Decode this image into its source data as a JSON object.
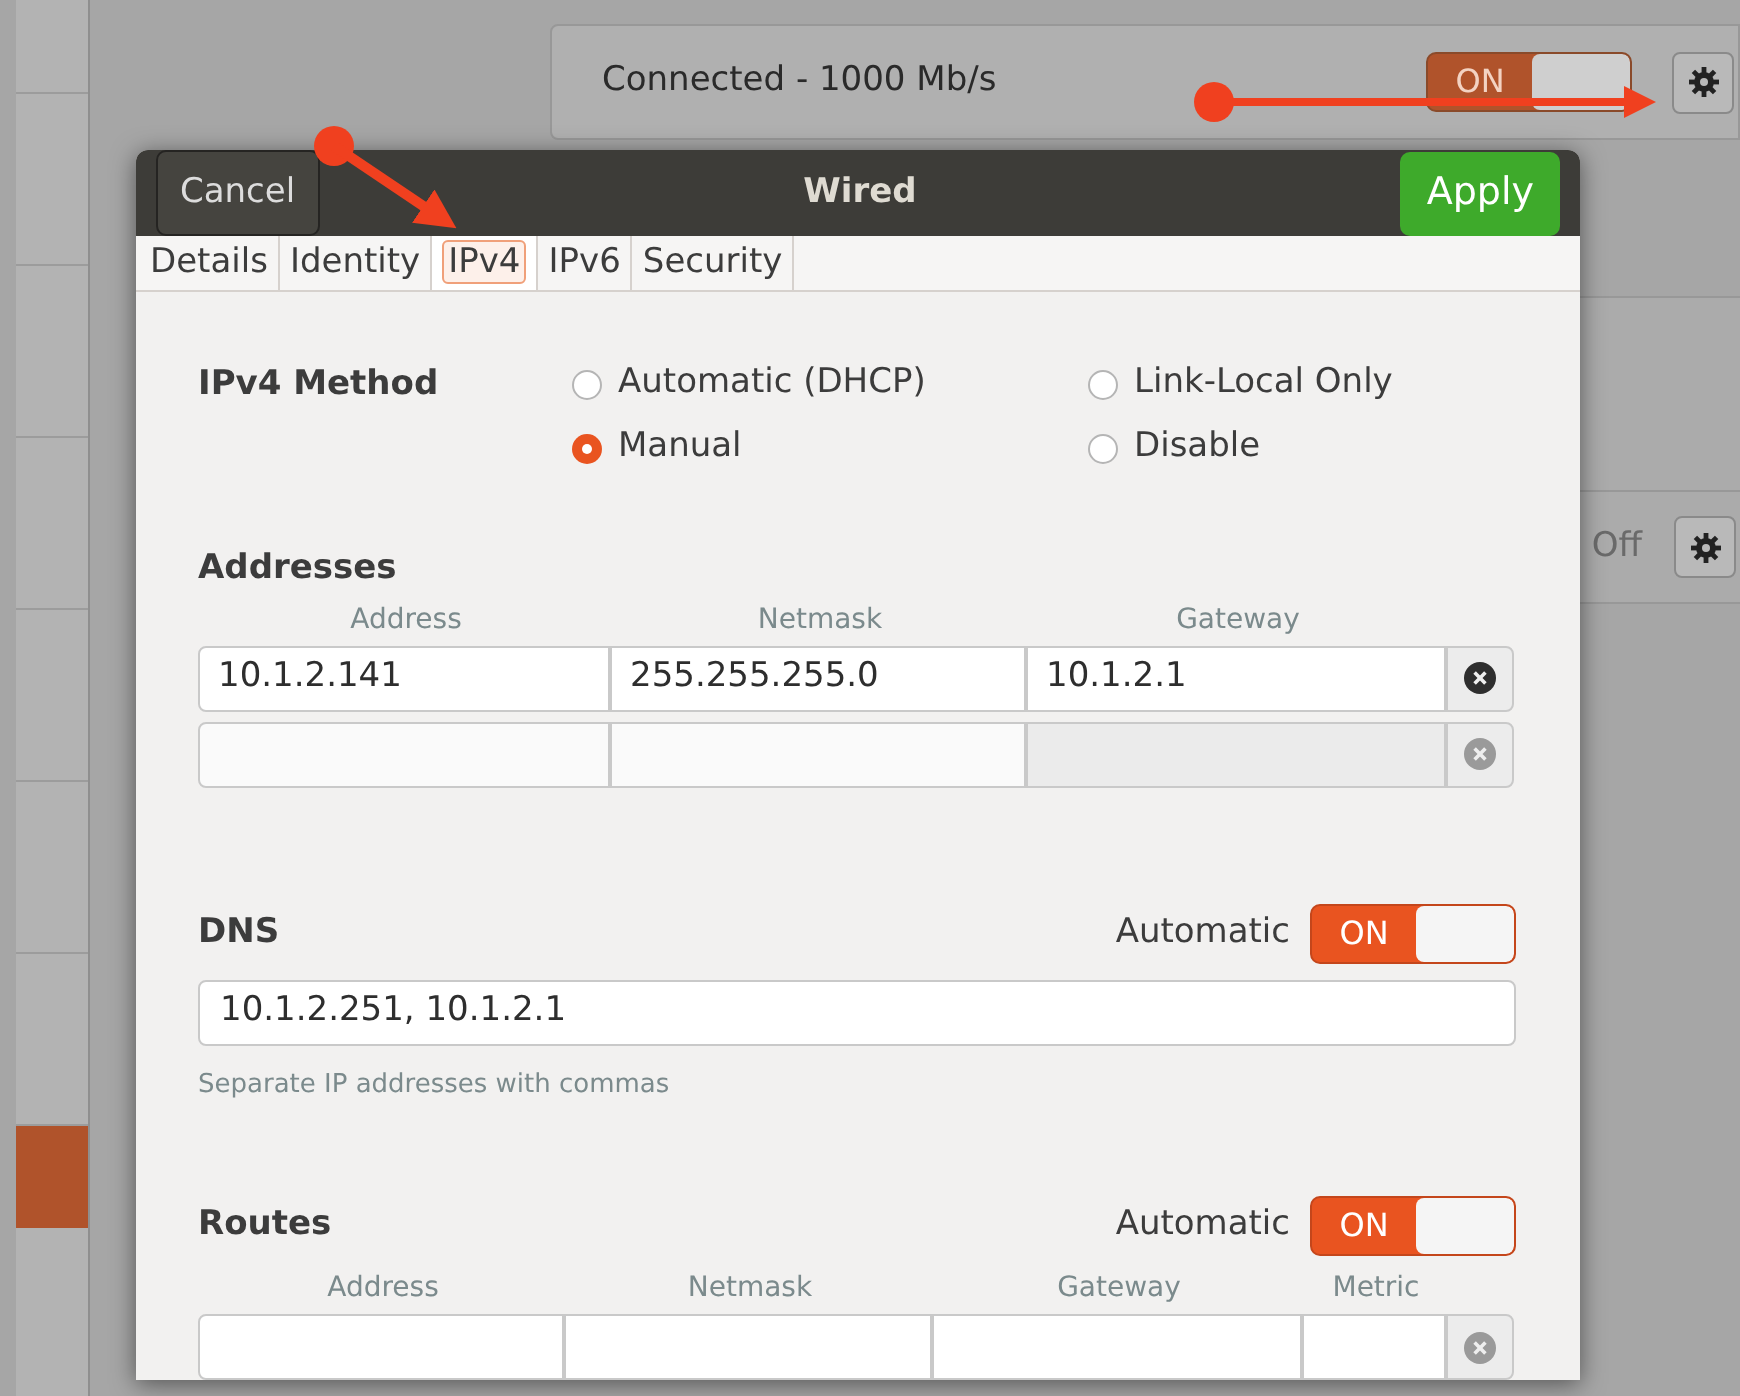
{
  "background": {
    "sidebar": {
      "items": [
        {
          "selected": false
        },
        {
          "selected": false
        },
        {
          "selected": false
        },
        {
          "selected": false
        },
        {
          "selected": false
        },
        {
          "selected": false
        },
        {
          "selected": true
        }
      ]
    },
    "connection": {
      "status": "Connected - 1000 Mb/s",
      "switch": {
        "label": "ON",
        "on": true
      }
    },
    "second_row": {
      "state": "Off"
    }
  },
  "dialog": {
    "title": "Wired",
    "cancel": "Cancel",
    "apply": "Apply",
    "tabs": [
      {
        "label": "Details",
        "selected": false
      },
      {
        "label": "Identity",
        "selected": false
      },
      {
        "label": "IPv4",
        "selected": true
      },
      {
        "label": "IPv6",
        "selected": false
      },
      {
        "label": "Security",
        "selected": false
      }
    ],
    "ipv4_method": {
      "label": "IPv4 Method",
      "options": [
        {
          "label": "Automatic (DHCP)",
          "selected": false
        },
        {
          "label": "Link-Local Only",
          "selected": false
        },
        {
          "label": "Manual",
          "selected": true
        },
        {
          "label": "Disable",
          "selected": false
        }
      ]
    },
    "addresses": {
      "title": "Addresses",
      "columns": [
        "Address",
        "Netmask",
        "Gateway"
      ],
      "rows": [
        {
          "kind": "entry",
          "values": [
            "10.1.2.141",
            "255.255.255.0",
            "10.1.2.1"
          ]
        },
        {
          "kind": "blank"
        }
      ]
    },
    "dns": {
      "title": "DNS",
      "automatic": "Automatic",
      "switch": {
        "label": "ON",
        "on": true
      },
      "value": "10.1.2.251, 10.1.2.1",
      "hint": "Separate IP addresses with commas"
    },
    "routes": {
      "title": "Routes",
      "automatic": "Automatic",
      "switch": {
        "label": "ON",
        "on": true
      },
      "columns": [
        "Address",
        "Netmask",
        "Gateway",
        "Metric"
      ]
    }
  }
}
